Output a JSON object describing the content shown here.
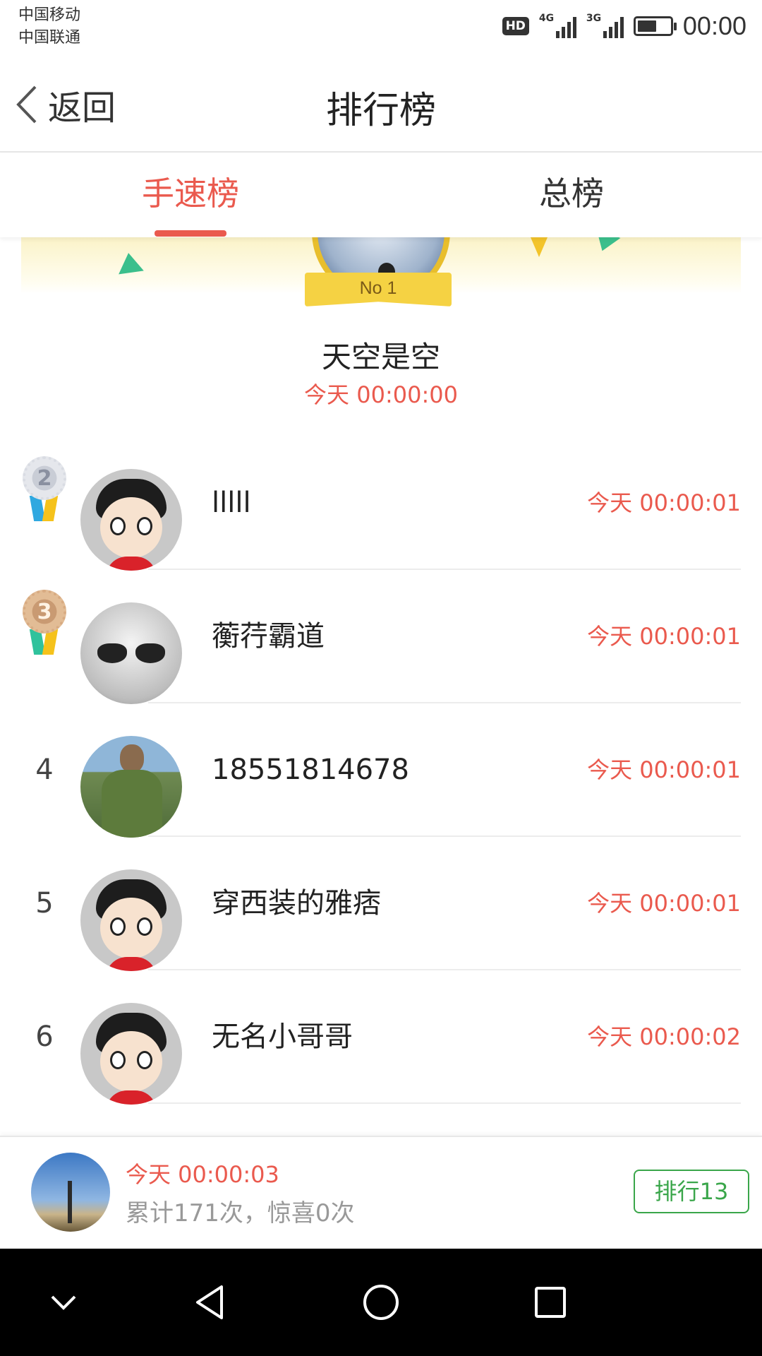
{
  "status": {
    "carrier1": "中国移动",
    "carrier2": "中国联通",
    "hd": "HD",
    "net1": "4G",
    "net2": "3G",
    "time": "00:00"
  },
  "header": {
    "back_label": "返回",
    "title": "排行榜"
  },
  "tabs": [
    {
      "label": "手速榜",
      "active": true
    },
    {
      "label": "总榜",
      "active": false
    }
  ],
  "winner": {
    "badge": "No 1",
    "name": "天空是空",
    "time": "今天 00:00:00"
  },
  "rows": [
    {
      "rank": "2",
      "name": "lllll",
      "time": "今天 00:00:01",
      "medal": "silver",
      "avatar": "cartoon"
    },
    {
      "rank": "3",
      "name": "蘅荇霸道",
      "time": "今天 00:00:01",
      "medal": "bronze",
      "avatar": "sketch"
    },
    {
      "rank": "4",
      "name": "18551814678",
      "time": "今天 00:00:01",
      "avatar": "soldier"
    },
    {
      "rank": "5",
      "name": "穿西装的雅痞",
      "time": "今天 00:00:01",
      "avatar": "cartoon"
    },
    {
      "rank": "6",
      "name": "无名小哥哥",
      "time": "今天 00:00:02",
      "avatar": "cartoon"
    }
  ],
  "mine": {
    "time": "今天 00:00:03",
    "stats": "累计171次，惊喜0次",
    "rank_button": "排行13"
  },
  "colors": {
    "accent": "#ea5a4e",
    "rank_button": "#3aa64a",
    "medal_gold": "#e8be2c"
  },
  "icons": [
    "back-chevron-icon",
    "hd-icon",
    "signal-icon",
    "battery-icon",
    "medal-icon",
    "nav-collapse-icon",
    "nav-back-icon",
    "nav-home-icon",
    "nav-recents-icon"
  ]
}
